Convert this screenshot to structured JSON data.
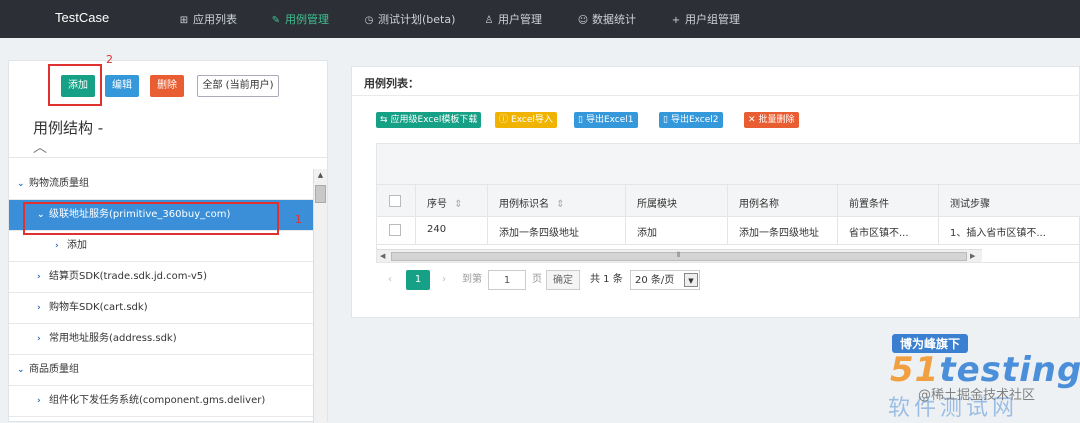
{
  "nav": {
    "brand": "TestCase",
    "items": [
      {
        "icon": "grid-icon",
        "glyph": "⊞",
        "label": "应用列表",
        "active": false
      },
      {
        "icon": "pencil-icon",
        "glyph": "✎",
        "label": "用例管理",
        "active": true
      },
      {
        "icon": "clock-icon",
        "glyph": "◷",
        "label": "测试计划(beta)",
        "active": false
      },
      {
        "icon": "user-icon",
        "glyph": "♙",
        "label": "用户管理",
        "active": false
      },
      {
        "icon": "smile-icon",
        "glyph": "☺",
        "label": "数据统计",
        "active": false
      },
      {
        "icon": "plus-icon",
        "glyph": "+",
        "label": "用户组管理",
        "active": false
      }
    ]
  },
  "left": {
    "buttons": {
      "add": "添加",
      "edit": "编辑",
      "delete": "删除",
      "all": "全部 (当前用户)"
    },
    "annotations": {
      "one": "1",
      "two": "2"
    },
    "tree_title": "用例结构 -",
    "tree_collapse_glyph": "︿",
    "tree": [
      {
        "label": "购物流质量组",
        "level": 0,
        "expanded": true,
        "selected": false
      },
      {
        "label": "级联地址服务(primitive_360buy_com)",
        "level": 1,
        "expanded": true,
        "selected": true
      },
      {
        "label": "添加",
        "level": 2,
        "expanded": false,
        "selected": false
      },
      {
        "label": "结算页SDK(trade.sdk.jd.com-v5)",
        "level": 1,
        "expanded": false,
        "selected": false
      },
      {
        "label": "购物车SDK(cart.sdk)",
        "level": 1,
        "expanded": false,
        "selected": false
      },
      {
        "label": "常用地址服务(address.sdk)",
        "level": 1,
        "expanded": false,
        "selected": false
      },
      {
        "label": "商品质量组",
        "level": 0,
        "expanded": true,
        "selected": false
      },
      {
        "label": "组件化下发任务系统(component.gms.deliver)",
        "level": 1,
        "expanded": false,
        "selected": false
      }
    ]
  },
  "right": {
    "title": "用例列表：",
    "toolbar": [
      {
        "icon": "import-icon",
        "glyph": "⇆",
        "label": "应用级Excel模板下载",
        "color": "#16a085"
      },
      {
        "icon": "info-icon",
        "glyph": "ⓘ",
        "label": "Excel导入",
        "color": "#f0b400"
      },
      {
        "icon": "file-icon",
        "glyph": "▯",
        "label": "导出Excel1",
        "color": "#3498db"
      },
      {
        "icon": "file-icon",
        "glyph": "▯",
        "label": "导出Excel2",
        "color": "#3498db"
      },
      {
        "icon": "trash-icon",
        "glyph": "🗑",
        "label": "批量删除",
        "color": "#e95d32"
      }
    ],
    "columns": [
      "序号",
      "用例标识名",
      "所属模块",
      "用例名称",
      "前置条件",
      "测试步骤"
    ],
    "sort_glyph": "⇕",
    "rows": [
      [
        "240",
        "添加一条四级地址",
        "添加",
        "添加一条四级地址",
        "省市区镇不...",
        "1、插入省市区镇不..."
      ]
    ],
    "pager": {
      "prev": "‹",
      "current_page": "1",
      "next": "›",
      "goto_label": "到第",
      "goto_value": "1",
      "page_suffix": "页",
      "confirm": "确定",
      "total": "共 1 条",
      "per_page": "20 条/页"
    }
  },
  "watermark": {
    "badge": "博为峰旗下",
    "logo_a": "51",
    "logo_b": "testing",
    "caption": "@稀土掘金技术社区",
    "subtitle": "软件测试网"
  }
}
